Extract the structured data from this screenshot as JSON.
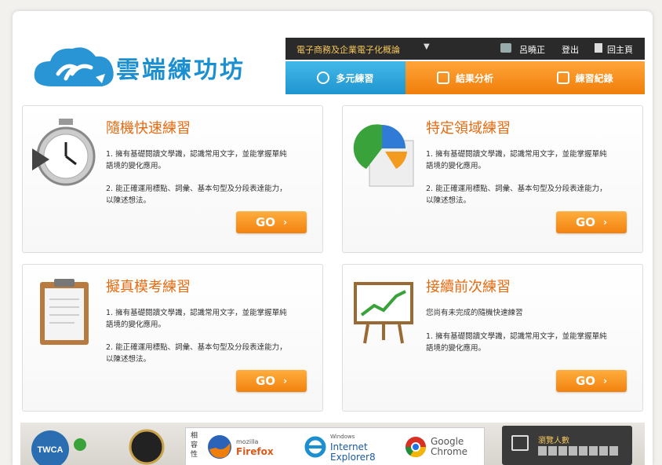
{
  "brand": {
    "name": "雲端練功坊",
    "color": "#1b8fd0"
  },
  "topbar": {
    "course": "電子商務及企業電子化概論",
    "user": "呂曉正",
    "logout": "登出",
    "home": "回主頁"
  },
  "tabs": [
    {
      "label": "多元練習",
      "icon": "clock-icon"
    },
    {
      "label": "結果分析",
      "icon": "report-icon"
    },
    {
      "label": "練習紀錄",
      "icon": "edit-icon"
    }
  ],
  "cards": [
    {
      "title": "隨機快速練習",
      "p1": "1. 擁有基礎閱讀文學識，認識常用文字，並能掌握單純語境的變化應用。",
      "p2": "2. 能正確運用標點、詞彙、基本句型及分段表達能力，以陳述想法。",
      "button": "GO",
      "icon": "stopwatch-icon"
    },
    {
      "title": "特定領域練習",
      "p1": "1. 擁有基礎閱讀文學識，認識常用文字，並能掌握單純語境的變化應用。",
      "p2": "2. 能正確運用標點、詞彙、基本句型及分段表達能力，以陳述想法。",
      "button": "GO",
      "icon": "pie-chart-icon"
    },
    {
      "title": "擬真模考練習",
      "p1": "1. 擁有基礎閱讀文學識，認識常用文字，並能掌握單純語境的變化應用。",
      "p2": "2. 能正確運用標點、詞彙、基本句型及分段表達能力，以陳述想法。",
      "button": "GO",
      "icon": "clipboard-icon"
    },
    {
      "title": "接續前次練習",
      "p1": "您尚有未完成的隨機快速練習",
      "p2": "1. 擁有基礎閱讀文學識，認識常用文字，並能掌握單純語境的變化應用。",
      "button": "GO",
      "icon": "easel-chart-icon"
    }
  ],
  "footer": {
    "twca": "TWCA",
    "compat_label": "相容性",
    "browsers": [
      {
        "name": "Firefox",
        "vendor": "mozilla"
      },
      {
        "name": "Internet Explorer8",
        "vendor": "Windows"
      },
      {
        "name": "Google Chrome",
        "vendor": ""
      }
    ],
    "visitors_label": "瀏覽人數"
  }
}
